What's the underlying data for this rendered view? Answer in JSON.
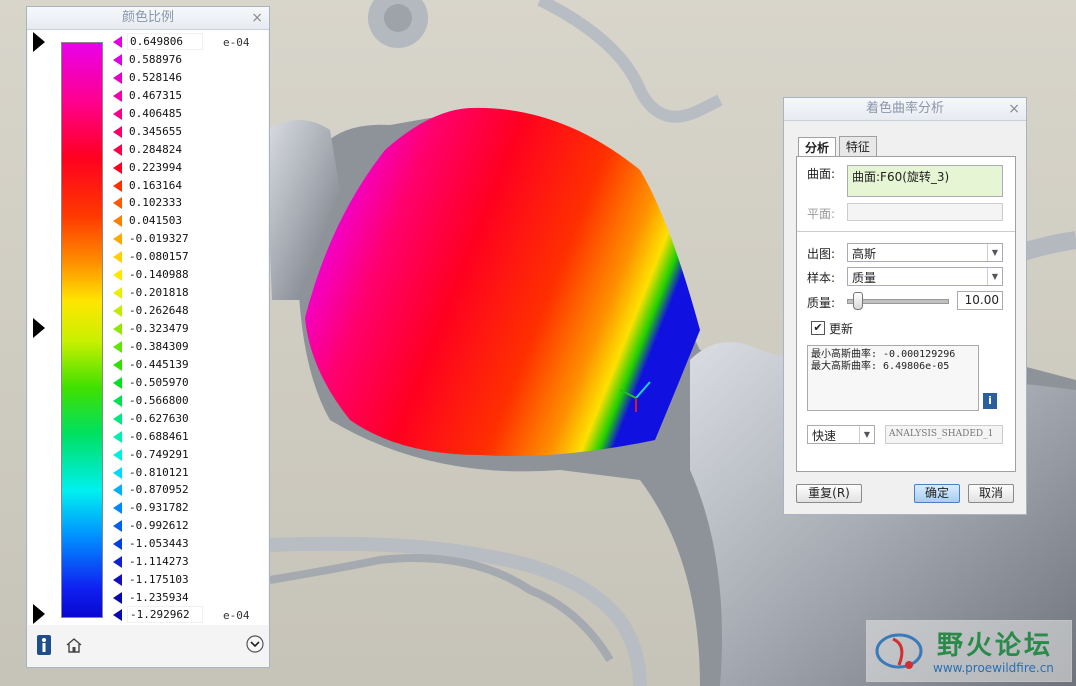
{
  "scale_panel": {
    "title": "颜色比例",
    "top_value": "0.649806",
    "bottom_value": "-1.292962",
    "exponent_top": "e-04",
    "exponent_bottom": "e-04",
    "ticks": [
      "0.588976",
      "0.528146",
      "0.467315",
      "0.406485",
      "0.345655",
      "0.284824",
      "0.223994",
      "0.163164",
      "0.102333",
      "0.041503",
      "-0.019327",
      "-0.080157",
      "-0.140988",
      "-0.201818",
      "-0.262648",
      "-0.323479",
      "-0.384309",
      "-0.445139",
      "-0.505970",
      "-0.566800",
      "-0.627630",
      "-0.688461",
      "-0.749291",
      "-0.810121",
      "-0.870952",
      "-0.931782",
      "-0.992612",
      "-1.053443",
      "-1.114273",
      "-1.175103",
      "-1.235934"
    ],
    "tick_colors": [
      "#e000e0",
      "#e800c8",
      "#f000a8",
      "#f80088",
      "#ff0068",
      "#ff0048",
      "#ff0020",
      "#ff3000",
      "#ff5a00",
      "#ff8000",
      "#ffa800",
      "#ffd000",
      "#ffe800",
      "#e8f000",
      "#c0ec00",
      "#90e800",
      "#60e400",
      "#30e000",
      "#00e020",
      "#00e050",
      "#00e880",
      "#00f0b0",
      "#00f0e0",
      "#00d8ff",
      "#00b0ff",
      "#0088ff",
      "#0060f0",
      "#0040e0",
      "#1020d0",
      "#1010c0",
      "#0808b0"
    ],
    "footer": {
      "info_icon": "info-icon",
      "home_icon": "home-icon",
      "expand_icon": "chevron-down-icon"
    }
  },
  "dialog": {
    "title": "着色曲率分析",
    "tabs": [
      "分析",
      "特征"
    ],
    "surface_label": "曲面:",
    "surface_value": "曲面:F60(旋转_3)",
    "plane_label": "平面:",
    "output_label": "出图:",
    "output_value": "高斯",
    "sample_label": "样本:",
    "sample_value": "质量",
    "quality_label": "质量:",
    "quality_value": "10.00",
    "quality_level": 0.1,
    "update_label": "更新",
    "update_checked": "✔",
    "result_lines": [
      "最小高斯曲率: -0.000129296",
      "最大高斯曲率: 6.49806e-05"
    ],
    "speed_value": "快速",
    "analysis_name": "ANALYSIS_SHADED_1",
    "buttons": {
      "repeat": "重复(R)",
      "ok": "确定",
      "cancel": "取消"
    }
  },
  "watermark": {
    "title": "野火论坛",
    "url": "www.proewildfire.cn"
  }
}
